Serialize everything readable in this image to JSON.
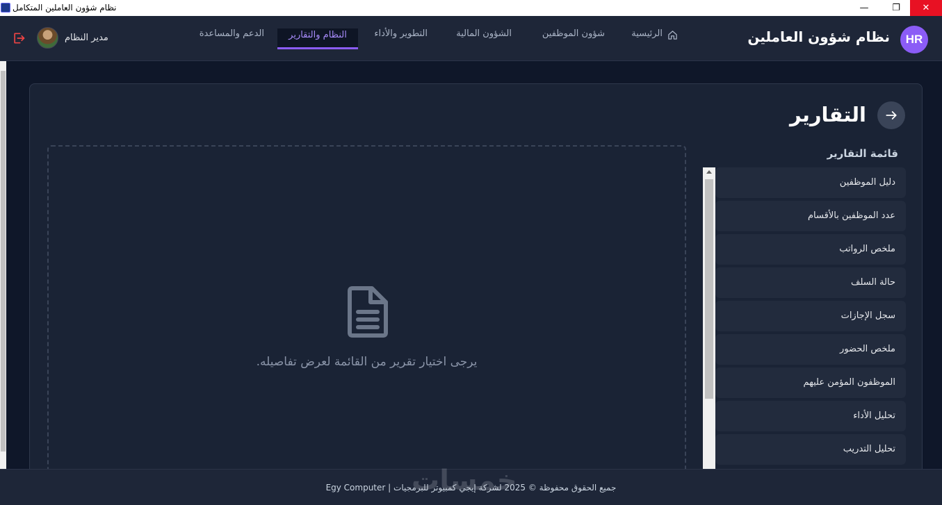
{
  "window": {
    "title": "نظام شؤون العاملين المتكامل",
    "minimize_glyph": "—",
    "maximize_glyph": "❐",
    "close_glyph": "✕"
  },
  "header": {
    "badge": "HR",
    "brand_title": "نظام شؤون العاملين",
    "nav": {
      "home": "الرئيسية",
      "employees": "شؤون الموظفين",
      "finance": "الشؤون المالية",
      "development": "التطوير والأداء",
      "system_reports": "النظام والتقارير",
      "support": "الدعم والمساعدة"
    },
    "active_nav": "system_reports",
    "user_name": "مدير النظام"
  },
  "page": {
    "title": "التقارير",
    "list_heading": "قائمة التقارير",
    "reports": [
      "دليل الموظفين",
      "عدد الموظفين بالأقسام",
      "ملخص الرواتب",
      "حالة السلف",
      "سجل الإجازات",
      "ملخص الحضور",
      "الموظفون المؤمن عليهم",
      "تحليل الأداء",
      "تحليل التدريب"
    ],
    "empty_state": "يرجى اختيار تقرير من القائمة لعرض تفاصيله."
  },
  "footer": {
    "text": "جميع الحقوق محفوظة © 2025 لشركة إيجي كمبيوتر للبرمجيات | Egy Computer"
  },
  "watermark": "خمسات",
  "colors": {
    "accent": "#8b5cf6",
    "background": "#0f1729",
    "surface": "#1a2335",
    "logout": "#ef4444"
  },
  "icons": [
    "app-icon",
    "home-icon",
    "logout-icon",
    "arrow-right-icon",
    "document-icon"
  ]
}
